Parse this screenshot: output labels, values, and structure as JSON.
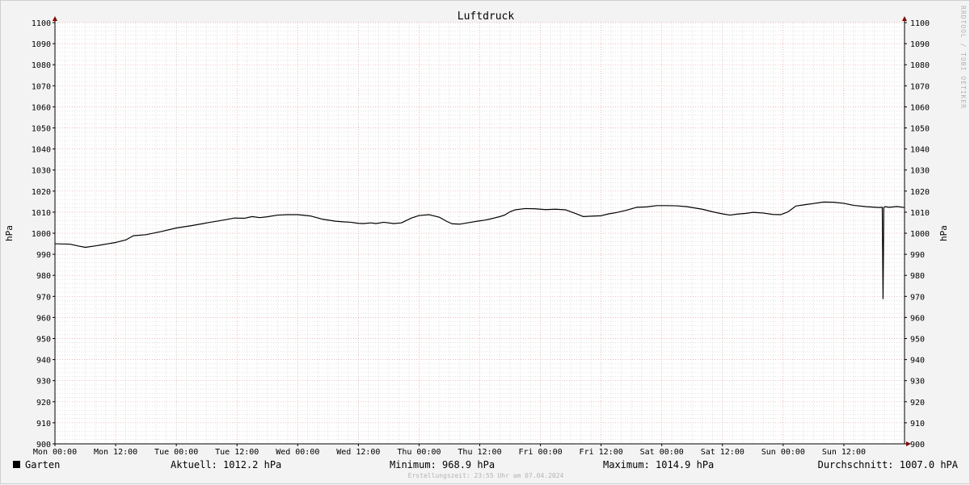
{
  "watermark": "RRDTOOL / TOBI OETIKER",
  "footer_text": "Erstellungszeit: 23:55 Uhr am 07.04.2024",
  "legend": {
    "series_name": "Garten",
    "current": "Aktuell: 1012.2 hPa",
    "minimum": "Minimum: 968.9 hPa",
    "maximum": "Maximum: 1014.9 hPa",
    "average": "Durchschnitt: 1007.0 hPA"
  },
  "colors": {
    "background": "#f3f3f3",
    "plot_background": "#ffffff",
    "line": "#000000",
    "major_grid": "#e5a0a0",
    "minor_grid": "#cfcfcf",
    "axis_arrow": "#880000"
  },
  "chart_data": {
    "type": "line",
    "title": "Luftdruck",
    "ylabel": "hPa",
    "ylabel_right": "hPa",
    "xlabel": "",
    "ylim": [
      900,
      1100
    ],
    "xlim": [
      0,
      168
    ],
    "x_unit": "hours since Mon 00:00",
    "y_ticks": [
      900,
      910,
      920,
      930,
      940,
      950,
      960,
      970,
      980,
      990,
      1000,
      1010,
      1020,
      1030,
      1040,
      1050,
      1060,
      1070,
      1080,
      1090,
      1100
    ],
    "x_ticks": [
      {
        "x": 0,
        "label": "Mon 00:00"
      },
      {
        "x": 12,
        "label": "Mon 12:00"
      },
      {
        "x": 24,
        "label": "Tue 00:00"
      },
      {
        "x": 36,
        "label": "Tue 12:00"
      },
      {
        "x": 48,
        "label": "Wed 00:00"
      },
      {
        "x": 60,
        "label": "Wed 12:00"
      },
      {
        "x": 72,
        "label": "Thu 00:00"
      },
      {
        "x": 84,
        "label": "Thu 12:00"
      },
      {
        "x": 96,
        "label": "Fri 00:00"
      },
      {
        "x": 108,
        "label": "Fri 12:00"
      },
      {
        "x": 120,
        "label": "Sat 00:00"
      },
      {
        "x": 132,
        "label": "Sat 12:00"
      },
      {
        "x": 144,
        "label": "Sun 00:00"
      },
      {
        "x": 156,
        "label": "Sun 12:00"
      }
    ],
    "grid": true,
    "series": [
      {
        "name": "Garten",
        "color": "#000000",
        "x": [
          0,
          3,
          4.5,
          6,
          8,
          10,
          12,
          14,
          15.5,
          18,
          21,
          24,
          27,
          30,
          33,
          35.5,
          37.5,
          39,
          40.5,
          42,
          44,
          46,
          48,
          50.5,
          53,
          55.5,
          57,
          58.5,
          60,
          61,
          62.5,
          63.5,
          65,
          67,
          68.5,
          70.5,
          72,
          74,
          76,
          77.5,
          78.5,
          80,
          82,
          84,
          85,
          86,
          87,
          88,
          89,
          90,
          91,
          93,
          95,
          97,
          99,
          101,
          103,
          104.5,
          106,
          108,
          109.5,
          111,
          113,
          115,
          117,
          119,
          121,
          123,
          125,
          128,
          130,
          132,
          133.5,
          135,
          136.5,
          138,
          140,
          142,
          143.5,
          145,
          146.5,
          148.5,
          150,
          152,
          154,
          156,
          158,
          160.5,
          163,
          163.6,
          163.75,
          163.9,
          164.2,
          165,
          166.5,
          168
        ],
        "y": [
          995,
          994.8,
          994,
          993.3,
          994,
          994.8,
          995.6,
          996.8,
          998.8,
          999.3,
          1000.8,
          1002.5,
          1003.6,
          1004.9,
          1006.1,
          1007.2,
          1007.1,
          1007.9,
          1007.4,
          1007.8,
          1008.6,
          1008.8,
          1008.8,
          1008.2,
          1006.6,
          1005.7,
          1005.4,
          1005.2,
          1004.7,
          1004.6,
          1004.9,
          1004.6,
          1005.2,
          1004.6,
          1004.9,
          1007.2,
          1008.4,
          1008.8,
          1007.6,
          1005.6,
          1004.5,
          1004.3,
          1005.1,
          1005.9,
          1006.2,
          1006.7,
          1007.3,
          1007.9,
          1008.7,
          1010.2,
          1011.1,
          1011.7,
          1011.6,
          1011.2,
          1011.4,
          1011.1,
          1009.3,
          1007.9,
          1008.1,
          1008.3,
          1009.2,
          1009.8,
          1010.9,
          1012.3,
          1012.5,
          1013.1,
          1013.1,
          1013,
          1012.6,
          1011.4,
          1010.2,
          1009.2,
          1008.6,
          1009.1,
          1009.4,
          1009.9,
          1009.6,
          1008.9,
          1008.8,
          1010.2,
          1012.9,
          1013.6,
          1014.1,
          1014.8,
          1014.7,
          1014.2,
          1013.2,
          1012.6,
          1012.2,
          1012.3,
          968.9,
          1012.3,
          1012.6,
          1012.3,
          1012.7,
          1012.2
        ]
      }
    ]
  }
}
